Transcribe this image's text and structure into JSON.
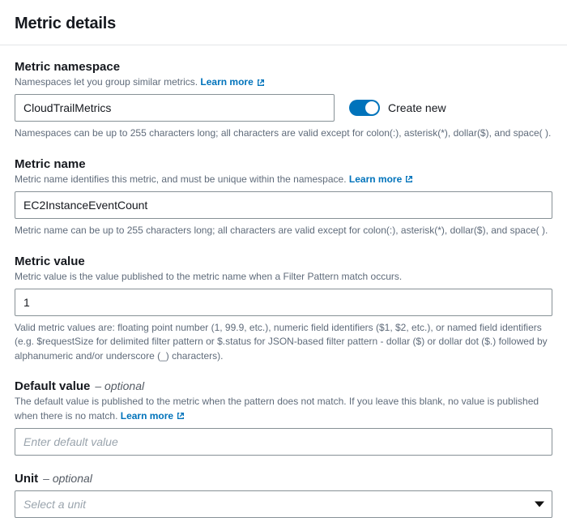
{
  "page_title": "Metric details",
  "learn_more_label": "Learn more",
  "fields": {
    "namespace": {
      "label": "Metric namespace",
      "desc": "Namespaces let you group similar metrics.",
      "value": "CloudTrailMetrics",
      "toggle_label": "Create new",
      "hint": "Namespaces can be up to 255 characters long; all characters are valid except for colon(:), asterisk(*), dollar($), and space( )."
    },
    "name": {
      "label": "Metric name",
      "desc": "Metric name identifies this metric, and must be unique within the namespace.",
      "value": "EC2InstanceEventCount",
      "hint": "Metric name can be up to 255 characters long; all characters are valid except for colon(:), asterisk(*), dollar($), and space( )."
    },
    "value": {
      "label": "Metric value",
      "desc": "Metric value is the value published to the metric name when a Filter Pattern match occurs.",
      "value": "1",
      "hint": "Valid metric values are: floating point number (1, 99.9, etc.), numeric field identifiers ($1, $2, etc.), or named field identifiers (e.g. $requestSize for delimited filter pattern or $.status for JSON-based filter pattern - dollar ($) or dollar dot ($.) followed by alphanumeric and/or underscore (_) characters)."
    },
    "default": {
      "label": "Default value",
      "optional": "– optional",
      "desc": "The default value is published to the metric when the pattern does not match. If you leave this blank, no value is published when there is no match.",
      "placeholder": "Enter default value"
    },
    "unit": {
      "label": "Unit",
      "optional": "– optional",
      "placeholder": "Select a unit"
    }
  }
}
